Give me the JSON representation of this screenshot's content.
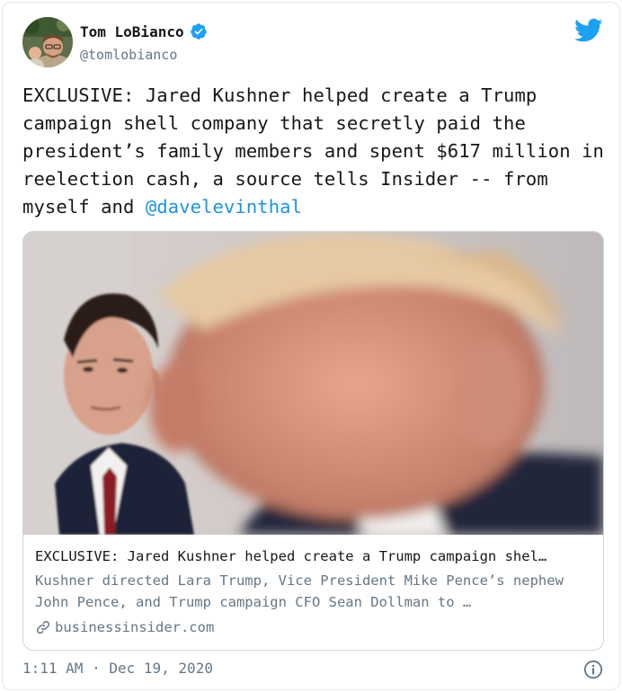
{
  "author": {
    "name": "Tom LoBianco",
    "handle": "@tomlobianco",
    "verified": true
  },
  "tweet": {
    "text_before_mention": "EXCLUSIVE: Jared Kushner helped create a Trump campaign shell company that secretly paid the president’s family members and spent $617 million in reelection cash, a source tells Insider -- from myself and ",
    "mention": "@davelevinthal"
  },
  "link_card": {
    "title": "EXCLUSIVE: Jared Kushner helped create a Trump campaign shel…",
    "description": "Kushner directed Lara Trump, Vice President Mike Pence’s nephew John Pence, and Trump campaign CFO Sean Dollman to …",
    "domain": "businessinsider.com"
  },
  "footer": {
    "time": "1:11 AM",
    "separator": "·",
    "date": "Dec 19, 2020"
  },
  "icons": {
    "logo": "twitter-bird-icon",
    "verified": "verified-badge-icon",
    "link": "link-icon",
    "info": "info-icon"
  },
  "colors": {
    "brand_blue": "#1da1f2",
    "mention_blue": "#1b95e0",
    "secondary_text": "#657786",
    "primary_text": "#14171a",
    "border": "#ccd6dd"
  }
}
